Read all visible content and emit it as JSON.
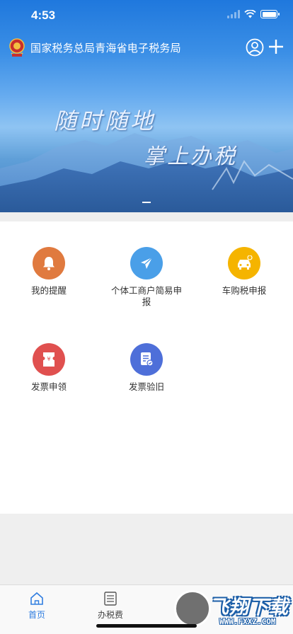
{
  "status_bar": {
    "time": "4:53"
  },
  "header": {
    "title": "国家税务总局青海省电子税务局"
  },
  "banner": {
    "slogan_line1": "随时随地",
    "slogan_line2": "掌上办税"
  },
  "services": [
    {
      "label": "我的提醒",
      "icon": "bell-icon",
      "color": "#e07a3f"
    },
    {
      "label": "个体工商户简易申报",
      "icon": "paper-plane-icon",
      "color": "#4a9fe8"
    },
    {
      "label": "车购税申报",
      "icon": "car-icon",
      "color": "#f5b400"
    },
    {
      "label": "发票申领",
      "icon": "ticket-icon",
      "color": "#e0504f"
    },
    {
      "label": "发票验旧",
      "icon": "document-check-icon",
      "color": "#4e6fd9"
    }
  ],
  "tabbar": {
    "tabs": [
      {
        "label": "首页",
        "icon": "home-icon",
        "active": true
      },
      {
        "label": "办税费",
        "icon": "list-icon",
        "active": false
      }
    ]
  },
  "watermark": {
    "text": "飞翔下载",
    "url": "WWW.FXXZ.COM"
  }
}
